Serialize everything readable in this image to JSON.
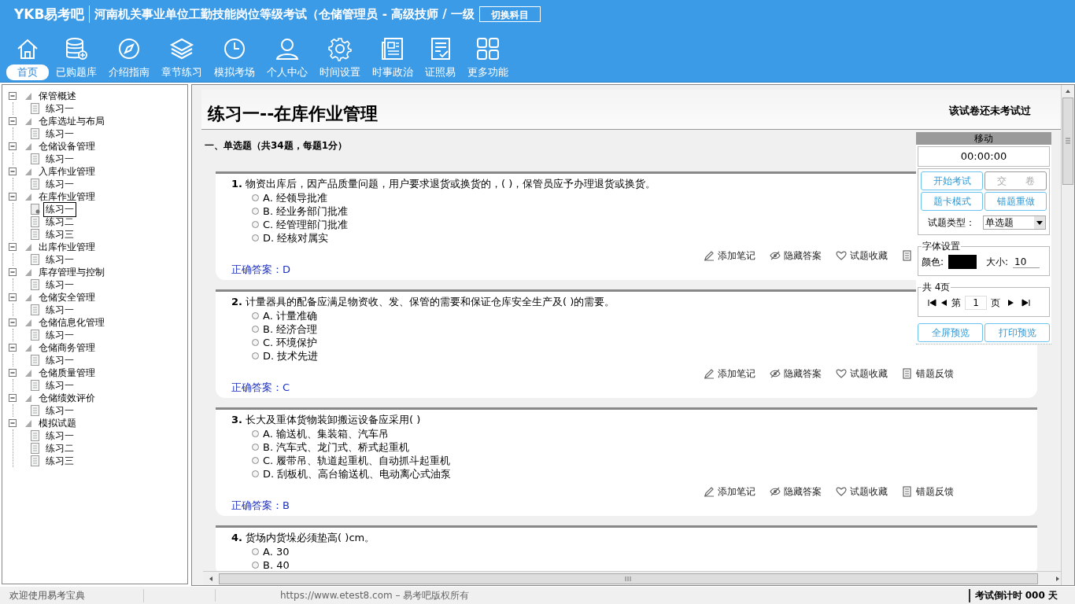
{
  "header": {
    "logo": "YKB易考吧",
    "exam_title": "河南机关事业单位工勤技能岗位等级考试（仓储管理员 - 高级技师 / 一级",
    "switch_button": "切换科目"
  },
  "nav": {
    "items": [
      {
        "kind": "home",
        "label": "首页",
        "selected": true
      },
      {
        "kind": "database",
        "label": "已购题库",
        "selected": false
      },
      {
        "kind": "compass",
        "label": "介绍指南",
        "selected": false
      },
      {
        "kind": "layers",
        "label": "章节练习",
        "selected": false
      },
      {
        "kind": "clock",
        "label": "模拟考场",
        "selected": false
      },
      {
        "kind": "person",
        "label": "个人中心",
        "selected": false
      },
      {
        "kind": "gear",
        "label": "时间设置",
        "selected": false
      },
      {
        "kind": "news",
        "label": "时事政治",
        "selected": false
      },
      {
        "kind": "checklist",
        "label": "证照易",
        "selected": false
      },
      {
        "kind": "grid",
        "label": "更多功能",
        "selected": false
      }
    ]
  },
  "tree": [
    {
      "label": "保管概述",
      "expanded": true,
      "children": [
        {
          "label": "练习一",
          "selected": false
        }
      ]
    },
    {
      "label": "仓库选址与布局",
      "expanded": true,
      "children": [
        {
          "label": "练习一",
          "selected": false
        }
      ]
    },
    {
      "label": "仓储设备管理",
      "expanded": true,
      "children": [
        {
          "label": "练习一",
          "selected": false
        }
      ]
    },
    {
      "label": "入库作业管理",
      "expanded": true,
      "children": [
        {
          "label": "练习一",
          "selected": false
        }
      ]
    },
    {
      "label": "在库作业管理",
      "expanded": true,
      "children": [
        {
          "label": "练习一",
          "selected": true
        },
        {
          "label": "练习二",
          "selected": false
        },
        {
          "label": "练习三",
          "selected": false
        }
      ]
    },
    {
      "label": "出库作业管理",
      "expanded": true,
      "children": [
        {
          "label": "练习一",
          "selected": false
        }
      ]
    },
    {
      "label": "库存管理与控制",
      "expanded": true,
      "children": [
        {
          "label": "练习一",
          "selected": false
        }
      ]
    },
    {
      "label": "仓储安全管理",
      "expanded": true,
      "children": [
        {
          "label": "练习一",
          "selected": false
        }
      ]
    },
    {
      "label": "仓储信息化管理",
      "expanded": true,
      "children": [
        {
          "label": "练习一",
          "selected": false
        }
      ]
    },
    {
      "label": "仓储商务管理",
      "expanded": true,
      "children": [
        {
          "label": "练习一",
          "selected": false
        }
      ]
    },
    {
      "label": "仓储质量管理",
      "expanded": true,
      "children": [
        {
          "label": "练习一",
          "selected": false
        }
      ]
    },
    {
      "label": "仓储绩效评价",
      "expanded": true,
      "children": [
        {
          "label": "练习一",
          "selected": false
        }
      ]
    },
    {
      "label": "模拟试题",
      "expanded": true,
      "children": [
        {
          "label": "练习一",
          "selected": false
        },
        {
          "label": "练习二",
          "selected": false
        },
        {
          "label": "练习三",
          "selected": false
        }
      ]
    }
  ],
  "content": {
    "title": "练习一--在库作业管理",
    "exam_status": "该试卷还未考试过",
    "section": "一、单选题（共34题，每题1分）",
    "questions": [
      {
        "text": "**1.** 物资出库后，因产品质量问题，用户要求退货或换货的，( )，保管员应予办理退货或换货。",
        "options": [
          {
            "text": "A. 经领导批准",
            "selected": false
          },
          {
            "text": "B. 经业务部门批准",
            "selected": false
          },
          {
            "text": "C. 经管理部门批准",
            "selected": false
          },
          {
            "text": "D. 经核对属实",
            "selected": false
          }
        ],
        "tools": [
          {
            "kind": "note",
            "label": "添加笔记"
          },
          {
            "kind": "hide",
            "label": "隐藏答案"
          },
          {
            "kind": "favorite",
            "label": "试题收藏"
          },
          {
            "kind": "feedback"
          }
        ],
        "answer": "正确答案：D"
      },
      {
        "text": "**2.** 计量器具的配备应满足物资收、发、保管的需要和保证仓库安全生产及( )的需要。",
        "options": [
          {
            "text": "A. 计量准确",
            "selected": false
          },
          {
            "text": "B. 经济合理",
            "selected": false
          },
          {
            "text": "C. 环境保护",
            "selected": false
          },
          {
            "text": "D. 技术先进",
            "selected": false
          }
        ],
        "tools": [
          {
            "kind": "note",
            "label": "添加笔记"
          },
          {
            "kind": "hide",
            "label": "隐藏答案"
          },
          {
            "kind": "favorite",
            "label": "试题收藏"
          },
          {
            "kind": "feedback",
            "label": "错题反馈"
          }
        ],
        "answer": "正确答案：C"
      },
      {
        "text": "**3.** 长大及重体货物装卸搬运设备应采用( )",
        "options": [
          {
            "text": "A. 输送机、集装箱、汽车吊",
            "selected": false
          },
          {
            "text": "B. 汽车式、龙门式、桥式起重机",
            "selected": false
          },
          {
            "text": "C. 履带吊、轨道起重机、自动抓斗起重机",
            "selected": false
          },
          {
            "text": "D. 刮板机、高台输送机、电动离心式油泵",
            "selected": false
          }
        ],
        "tools": [
          {
            "kind": "note",
            "label": "添加笔记"
          },
          {
            "kind": "hide",
            "label": "隐藏答案"
          },
          {
            "kind": "favorite",
            "label": "试题收藏"
          },
          {
            "kind": "feedback",
            "label": "错题反馈"
          }
        ],
        "answer": "正确答案：B"
      },
      {
        "text": "**4.** 货场内货垛必须垫高( )cm。",
        "options": [
          {
            "text": "A. 30",
            "selected": false
          },
          {
            "text": "B. 40",
            "selected": false
          }
        ]
      }
    ]
  },
  "panel": {
    "drag_title": "移动",
    "timer": "00:00:00",
    "buttons": [
      {
        "label": "开始考试",
        "disabled": false
      },
      {
        "label": "交　　卷",
        "disabled": true
      },
      {
        "label": "题卡模式",
        "disabled": false
      },
      {
        "label": "错题重做",
        "disabled": false
      }
    ],
    "type_label": "试题类型：",
    "type_value": "单选题",
    "font_legend": "字体设置",
    "color_label": "颜色:",
    "size_label": "大小:",
    "size_value": "10",
    "pages_legend": "共 4页",
    "page_prefix": "第",
    "page_value": "1",
    "page_suffix": "页",
    "preview_buttons": [
      "全屏预览",
      "打印预览"
    ]
  },
  "status_bar": {
    "welcome": "欢迎使用易考宝典",
    "copyright": "https://www.etest8.com – 易考吧版权所有",
    "countdown": "考试倒计时 000 天"
  }
}
